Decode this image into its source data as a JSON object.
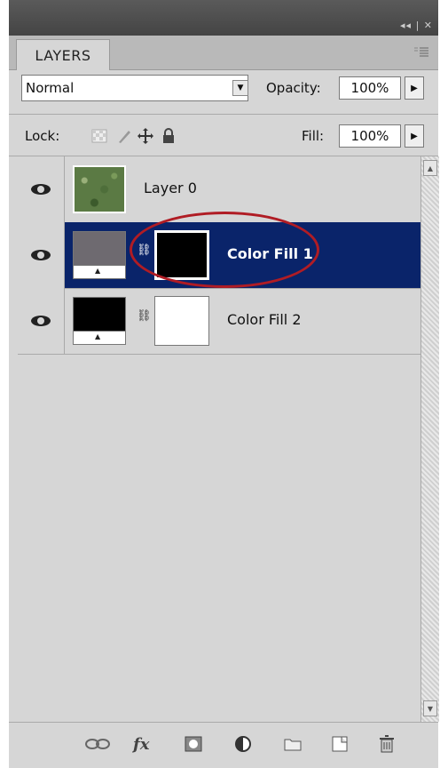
{
  "titlebar": {
    "controls": "◂◂ | ✕"
  },
  "panel": {
    "tab_label": "LAYERS",
    "menu_icon": "panel-menu-icon"
  },
  "blend": {
    "mode": "Normal",
    "opacity_label": "Opacity:",
    "opacity_value": "100%"
  },
  "lock": {
    "label": "Lock:",
    "fill_label": "Fill:",
    "fill_value": "100%"
  },
  "layers": [
    {
      "name": "Layer 0",
      "visible": true,
      "selected": false,
      "thumb": "texture"
    },
    {
      "name": "Color Fill 1",
      "visible": true,
      "selected": true,
      "fill_color": "#6e6a70",
      "mask_color": "#000000"
    },
    {
      "name": "Color Fill 2",
      "visible": true,
      "selected": false,
      "fill_color": "#000000",
      "mask_color": "#ffffff"
    }
  ],
  "colors": {
    "selection": "#0a246a",
    "highlight_ellipse": "#b01c24",
    "panel_bg": "#d6d6d6"
  },
  "bottom_icons": [
    "link-layers-icon",
    "fx-icon",
    "add-mask-icon",
    "adjustment-layer-icon",
    "new-group-icon",
    "new-layer-icon",
    "trash-icon"
  ],
  "bottom_labels": {
    "fx": "fx"
  }
}
